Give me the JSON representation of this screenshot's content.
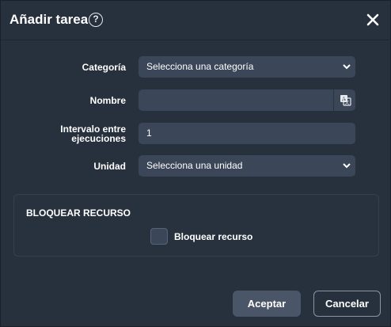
{
  "dialog": {
    "title": "Añadir tarea",
    "help_icon": "?",
    "close_icon": "close-icon"
  },
  "form": {
    "category_label": "Categoría",
    "category_value": "Selecciona una categoría",
    "name_label": "Nombre",
    "name_value": "",
    "translate_icon": "translate-icon",
    "interval_label_line1": "Intervalo entre",
    "interval_label_line2": "ejecuciones",
    "interval_value": "1",
    "unit_label": "Unidad",
    "unit_value": "Selecciona una unidad"
  },
  "lock_panel": {
    "title": "BLOQUEAR RECURSO",
    "checkbox_label": "Bloquear recurso",
    "checked": false
  },
  "buttons": {
    "accept": "Aceptar",
    "cancel": "Cancelar"
  },
  "colors": {
    "background": "#27313d",
    "field": "#3b4758",
    "accept_button": "#4a5668"
  }
}
